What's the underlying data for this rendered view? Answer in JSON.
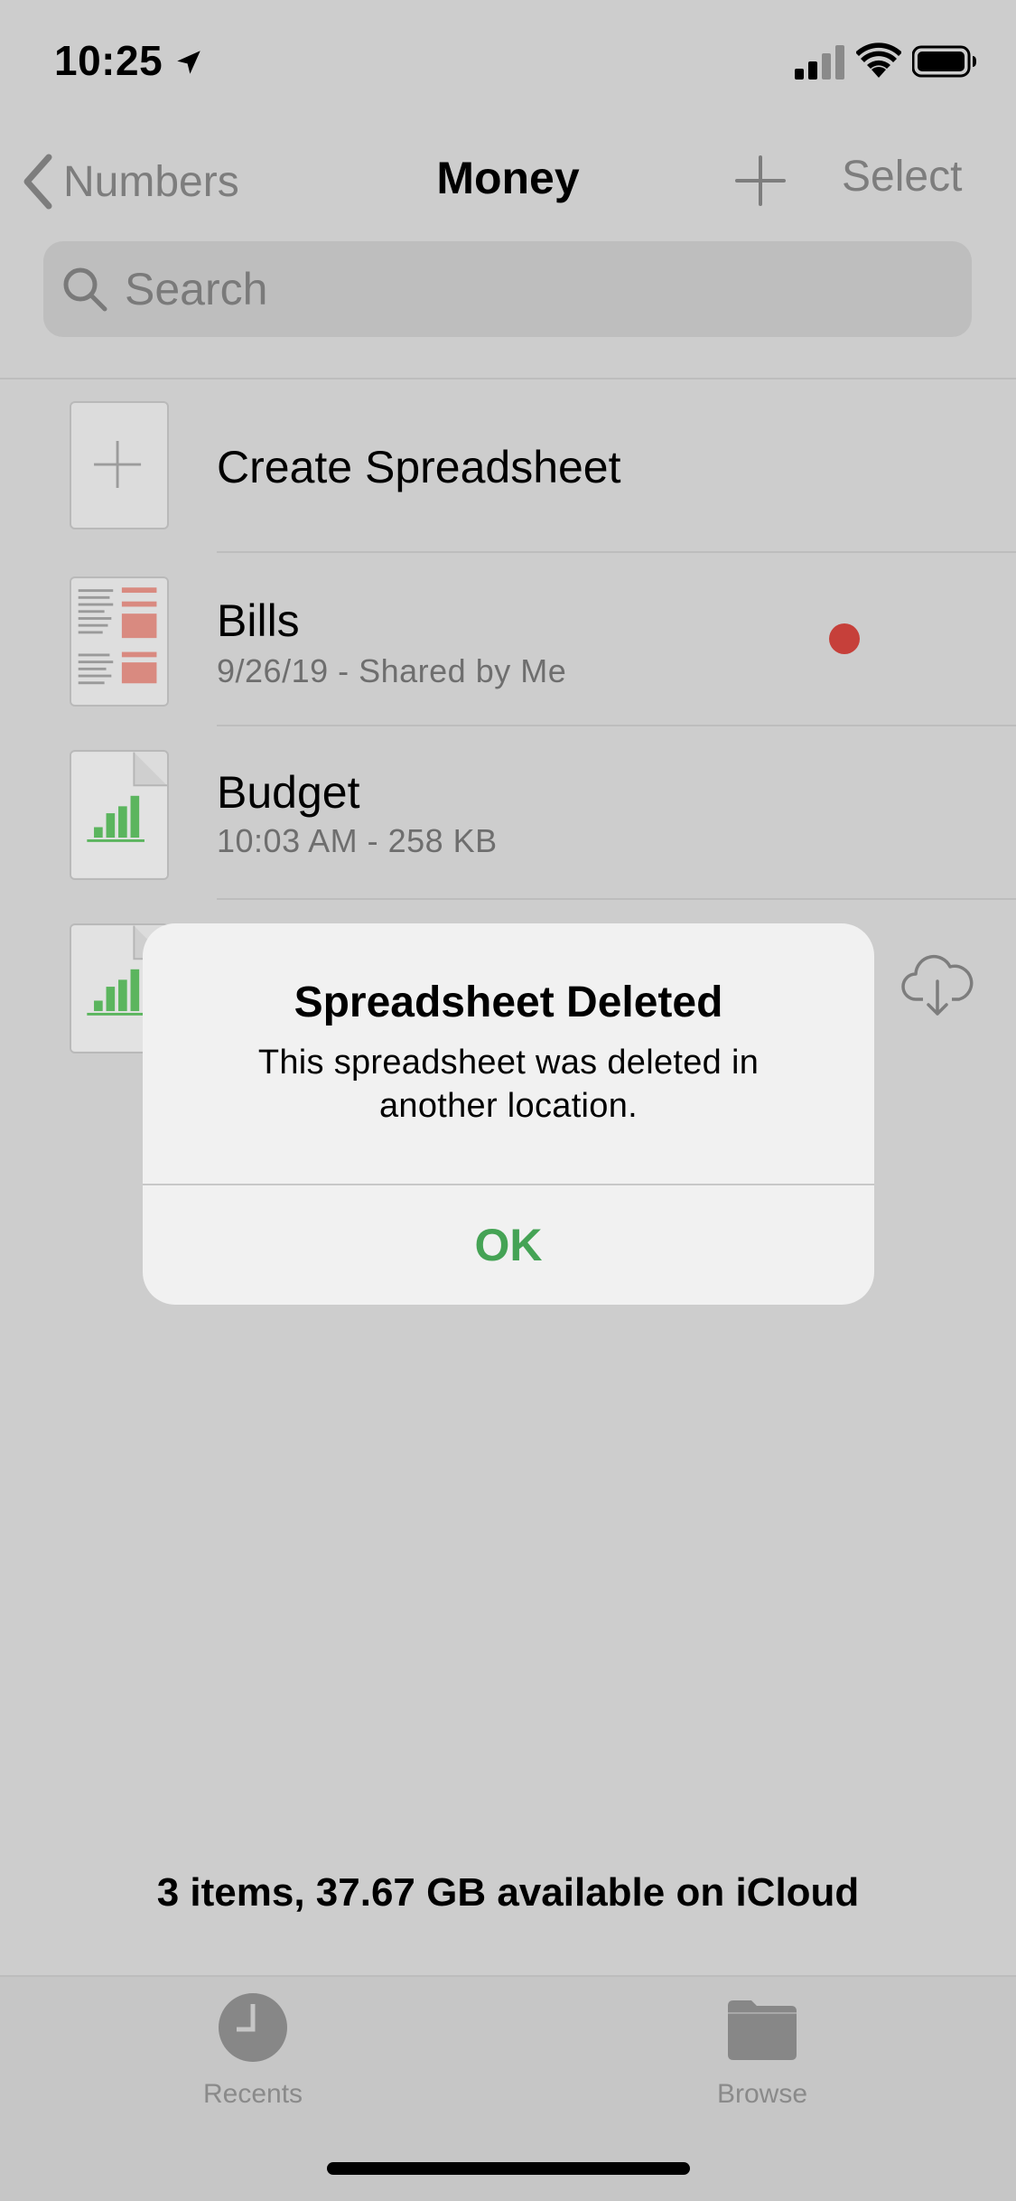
{
  "status_bar": {
    "time": "10:25"
  },
  "nav": {
    "back_label": "Numbers",
    "title": "Money",
    "select_label": "Select"
  },
  "search": {
    "placeholder": "Search"
  },
  "list": {
    "create_label": "Create Spreadsheet",
    "items": [
      {
        "title": "Bills",
        "subtitle": "9/26/19 - Shared by Me"
      },
      {
        "title": "Budget",
        "subtitle": "10:03 AM - 258 KB"
      }
    ]
  },
  "alert": {
    "title": "Spreadsheet Deleted",
    "message": "This spreadsheet was deleted in another location.",
    "ok_label": "OK"
  },
  "footer": {
    "info": "3 items, 37.67 GB available on iCloud"
  },
  "tabbar": {
    "tabs": [
      {
        "label": "Recents",
        "icon": "clock-icon"
      },
      {
        "label": "Browse",
        "icon": "folder-icon"
      }
    ]
  },
  "colors": {
    "accent_green": "#45a355",
    "badge_red": "#c6403a",
    "dimmed_background": "#cdcdcd"
  }
}
